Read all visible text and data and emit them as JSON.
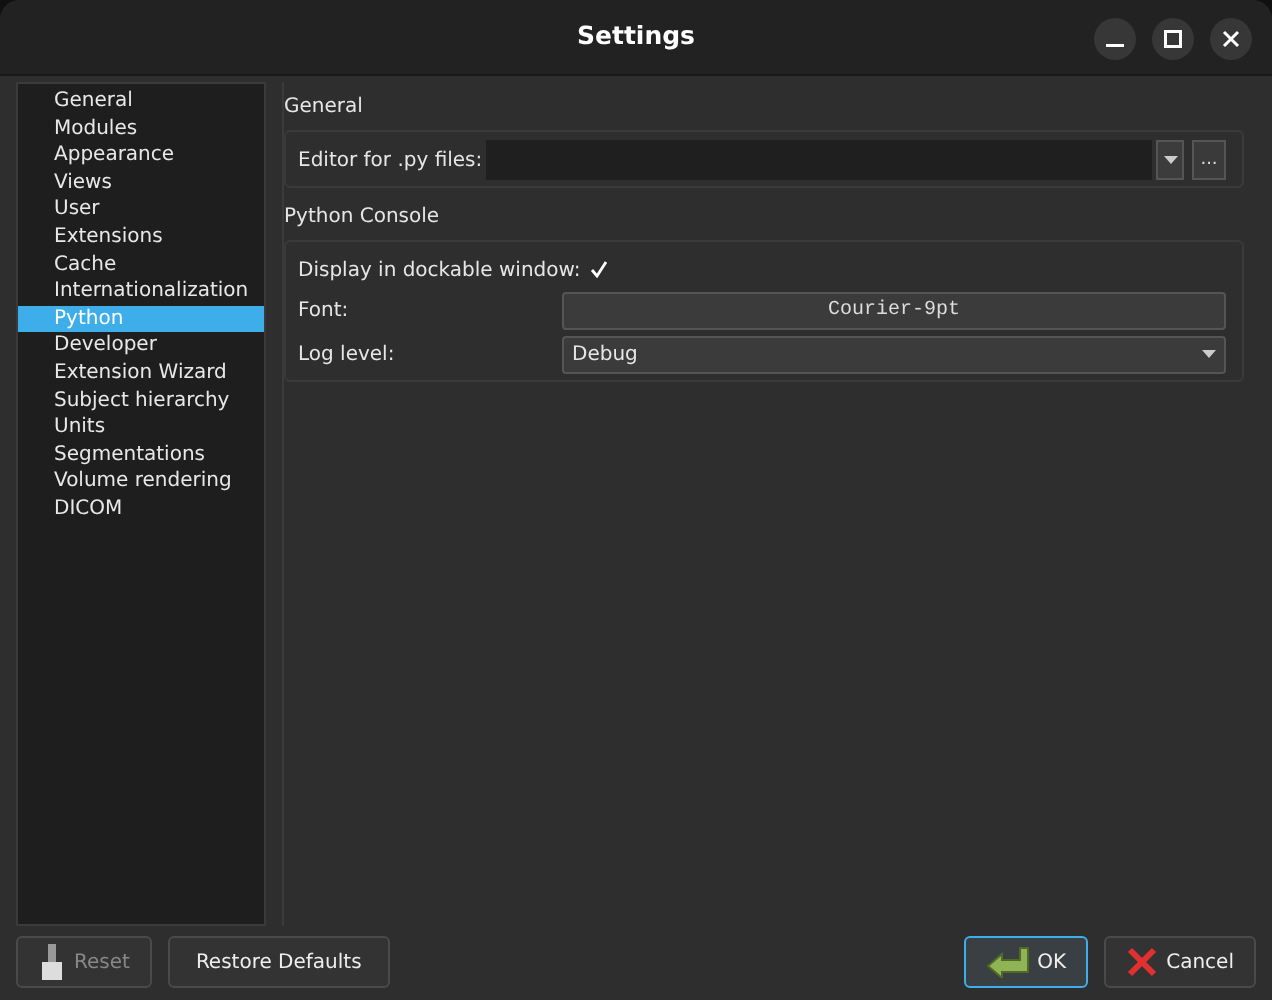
{
  "window": {
    "title": "Settings"
  },
  "sidebar": {
    "items": [
      {
        "label": "General",
        "selected": false
      },
      {
        "label": "Modules",
        "selected": false
      },
      {
        "label": "Appearance",
        "selected": false
      },
      {
        "label": "Views",
        "selected": false
      },
      {
        "label": "User",
        "selected": false
      },
      {
        "label": "Extensions",
        "selected": false
      },
      {
        "label": "Cache",
        "selected": false
      },
      {
        "label": "Internationalization",
        "selected": false
      },
      {
        "label": "Python",
        "selected": true
      },
      {
        "label": "Developer",
        "selected": false
      },
      {
        "label": "Extension Wizard",
        "selected": false
      },
      {
        "label": "Subject hierarchy",
        "selected": false
      },
      {
        "label": "Units",
        "selected": false
      },
      {
        "label": "Segmentations",
        "selected": false
      },
      {
        "label": "Volume rendering",
        "selected": false
      },
      {
        "label": "DICOM",
        "selected": false
      }
    ]
  },
  "general": {
    "title": "General",
    "editor_label": "Editor for .py files:",
    "browse_button": "..."
  },
  "python_console": {
    "title": "Python Console",
    "dockable_label": "Display in dockable window:",
    "dockable_checked": true,
    "font_label": "Font:",
    "font_button": "Courier-9pt",
    "log_level_label": "Log level:",
    "log_level": "Debug"
  },
  "buttons": [
    {
      "label": "Reset",
      "kind": "reset",
      "disabled": true
    },
    {
      "label": "Restore Defaults",
      "kind": "plain",
      "disabled": false
    },
    {
      "label": "OK",
      "kind": "ok",
      "disabled": false
    },
    {
      "label": "Cancel",
      "kind": "cancel",
      "disabled": false
    }
  ]
}
